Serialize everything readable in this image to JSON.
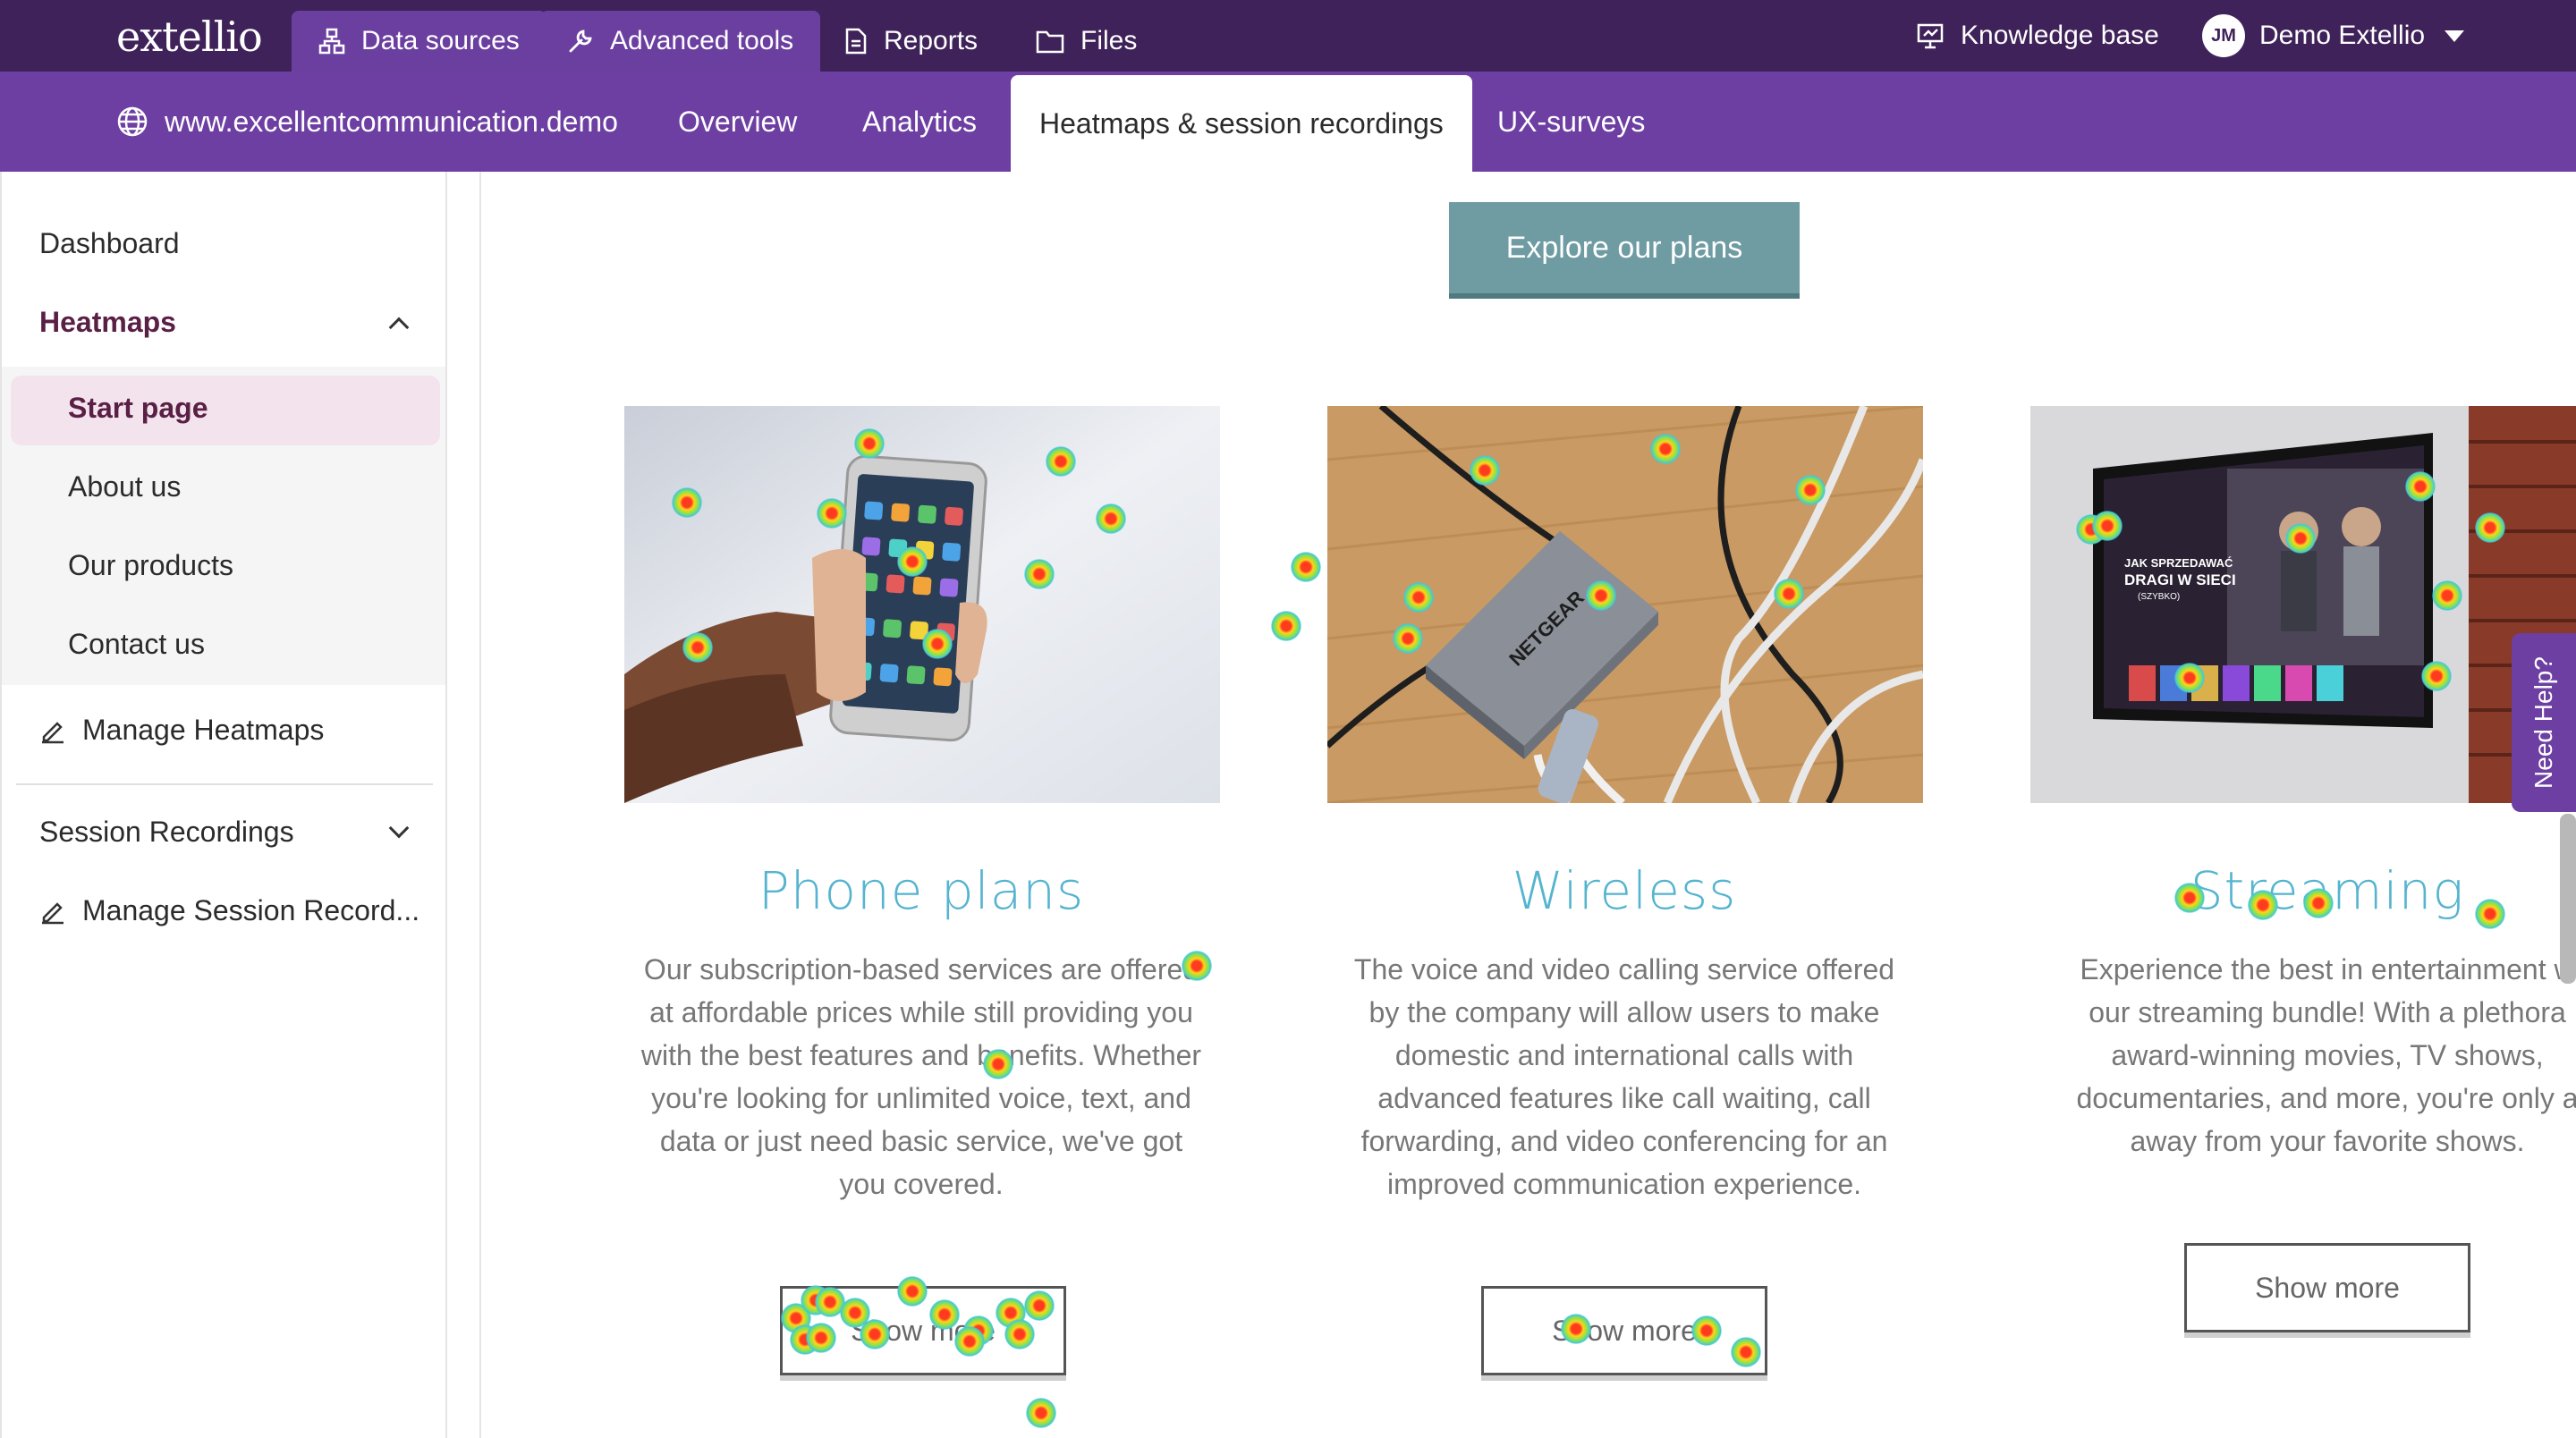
{
  "app": {
    "logo": "extellio"
  },
  "topnav": {
    "tabs": [
      {
        "label": "Data sources",
        "icon": "sitemap-icon"
      },
      {
        "label": "Advanced tools",
        "icon": "wrench-icon"
      },
      {
        "label": "Reports",
        "icon": "document-icon"
      },
      {
        "label": "Files",
        "icon": "folder-icon"
      }
    ],
    "knowledge_base": "Knowledge base",
    "user": {
      "initials": "JM",
      "name": "Demo Extellio"
    }
  },
  "subnav": {
    "site": "www.excellentcommunication.demo",
    "tabs": [
      "Overview",
      "Analytics",
      "Heatmaps & session recordings",
      "UX-surveys"
    ],
    "active_tab": "Heatmaps & session recordings"
  },
  "sidebar": {
    "dashboard": "Dashboard",
    "heatmaps": "Heatmaps",
    "pages": [
      "Start page",
      "About us",
      "Our products",
      "Contact us"
    ],
    "active_page": "Start page",
    "manage_heatmaps": "Manage Heatmaps",
    "session_recordings": "Session Recordings",
    "manage_session_recordings": "Manage Session Record..."
  },
  "page": {
    "explore_button": "Explore our plans",
    "cards": [
      {
        "title": "Phone plans",
        "lines": [
          "Our subscription-based services are offered",
          "at affordable prices while still providing you",
          "with the best features and benefits. Whether",
          "you're looking for unlimited voice, text, and",
          "data or just need basic service, we've got",
          "you covered."
        ],
        "button": "Show more"
      },
      {
        "title": "Wireless",
        "lines": [
          "The voice and video calling service offered",
          "by the company will allow users to make",
          "domestic and international calls with",
          "advanced features like call waiting, call",
          "forwarding, and video conferencing for an",
          "improved communication experience."
        ],
        "button": "Show more"
      },
      {
        "title": "Streaming",
        "lines": [
          "Experience the best in entertainment w",
          "our streaming bundle! With a plethora",
          "award-winning movies, TV shows,",
          "documentaries, and more, you're only a",
          "away from your favorite shows."
        ],
        "button": "Show more"
      }
    ],
    "tv_screen": {
      "line1": "JAK SPRZEDAWAĆ",
      "line2": "DRAGI W SIECI",
      "line3": "(SZYBKO)"
    },
    "router_brand": "NETGEAR"
  },
  "need_help": "Need Help?",
  "colors": {
    "topbar": "#3f2259",
    "subnav": "#6d3fa3",
    "accent_teal": "#55b4cf",
    "button_teal": "#6e9ca2",
    "active_sidebar": "#f3e3ec"
  }
}
